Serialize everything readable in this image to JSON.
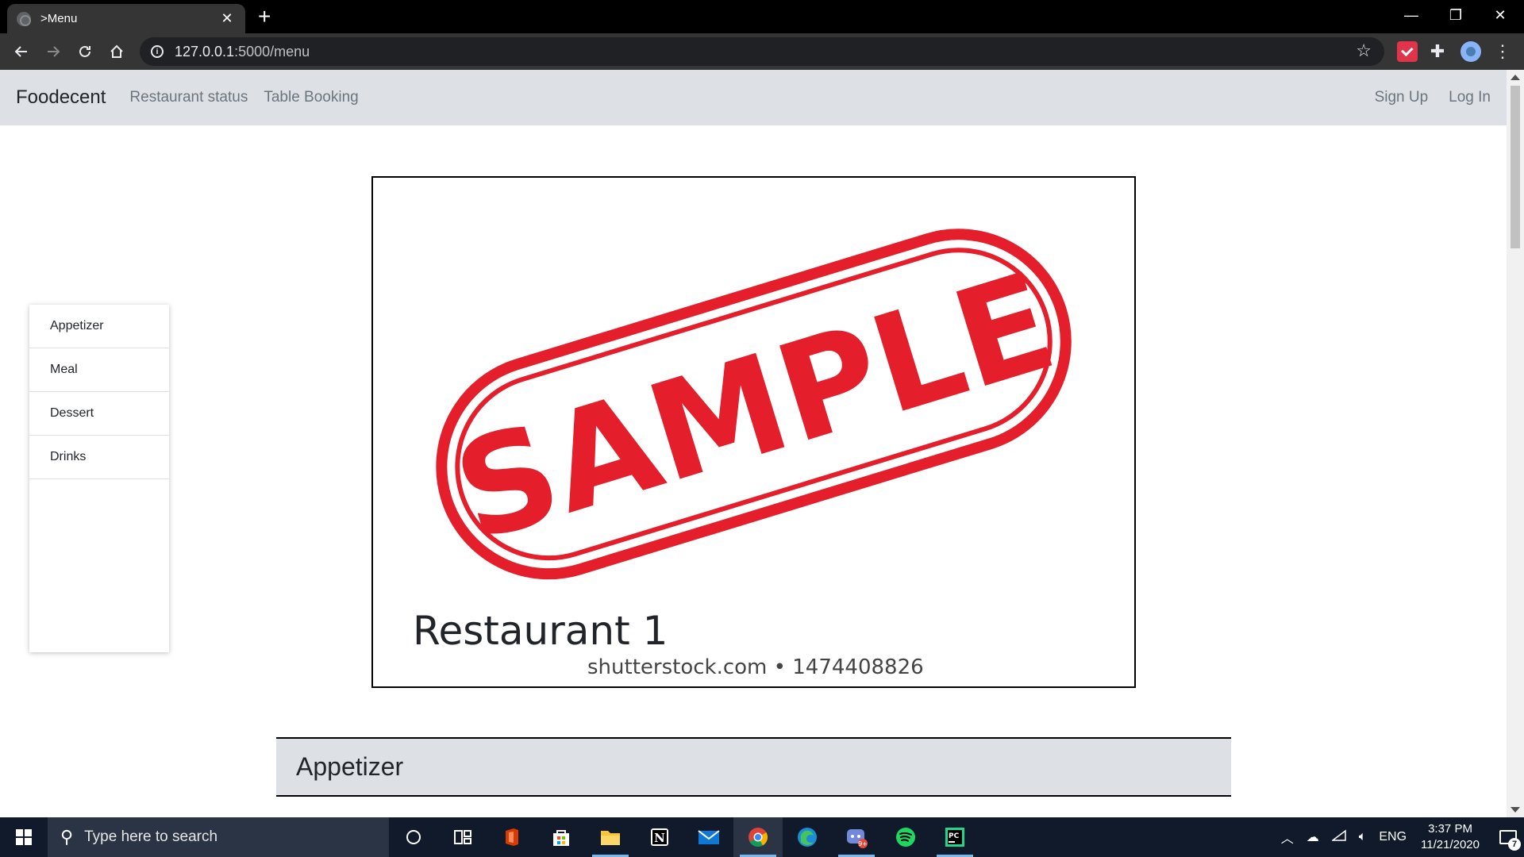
{
  "browser": {
    "tab_title": ">Menu",
    "tab_close": "✕",
    "new_tab": "+",
    "url_host": "127.0.0.1",
    "url_path": ":5000/menu",
    "window_controls": {
      "minimize": "—",
      "restore": "❐",
      "close": "✕"
    },
    "icons": [
      "back-icon",
      "forward-icon",
      "reload-icon",
      "home-icon",
      "info-icon",
      "star-icon",
      "pocket-icon",
      "puzzle-icon",
      "profile-icon",
      "menu-icon"
    ]
  },
  "navbar": {
    "brand": "Foodecent",
    "links": [
      "Restaurant status",
      "Table Booking"
    ],
    "right_links": [
      "Sign Up",
      "Log In"
    ]
  },
  "sidebar": {
    "items": [
      "Appetizer",
      "Meal",
      "Dessert",
      "Drinks"
    ]
  },
  "card": {
    "stamp_text": "SAMPLE",
    "title": "Restaurant 1",
    "watermark": "shutterstock.com • 1474408826",
    "stamp_color": "#e41e2b"
  },
  "section": {
    "title": "Appetizer"
  },
  "taskbar": {
    "search_placeholder": "Type here to search",
    "apps": [
      "cortana-icon",
      "task-view-icon",
      "office-icon",
      "store-icon",
      "file-explorer-icon",
      "notion-icon",
      "mail-icon",
      "chrome-icon",
      "edge-icon",
      "discord-icon",
      "spotify-icon",
      "pycharm-icon"
    ],
    "language": "ENG",
    "time": "3:37 PM",
    "date": "11/21/2020",
    "notification_count": "7"
  },
  "colors": {
    "navbar_bg": "#dde1e6",
    "taskbar_bg": "#101a2b",
    "browser_chrome": "#353535"
  }
}
